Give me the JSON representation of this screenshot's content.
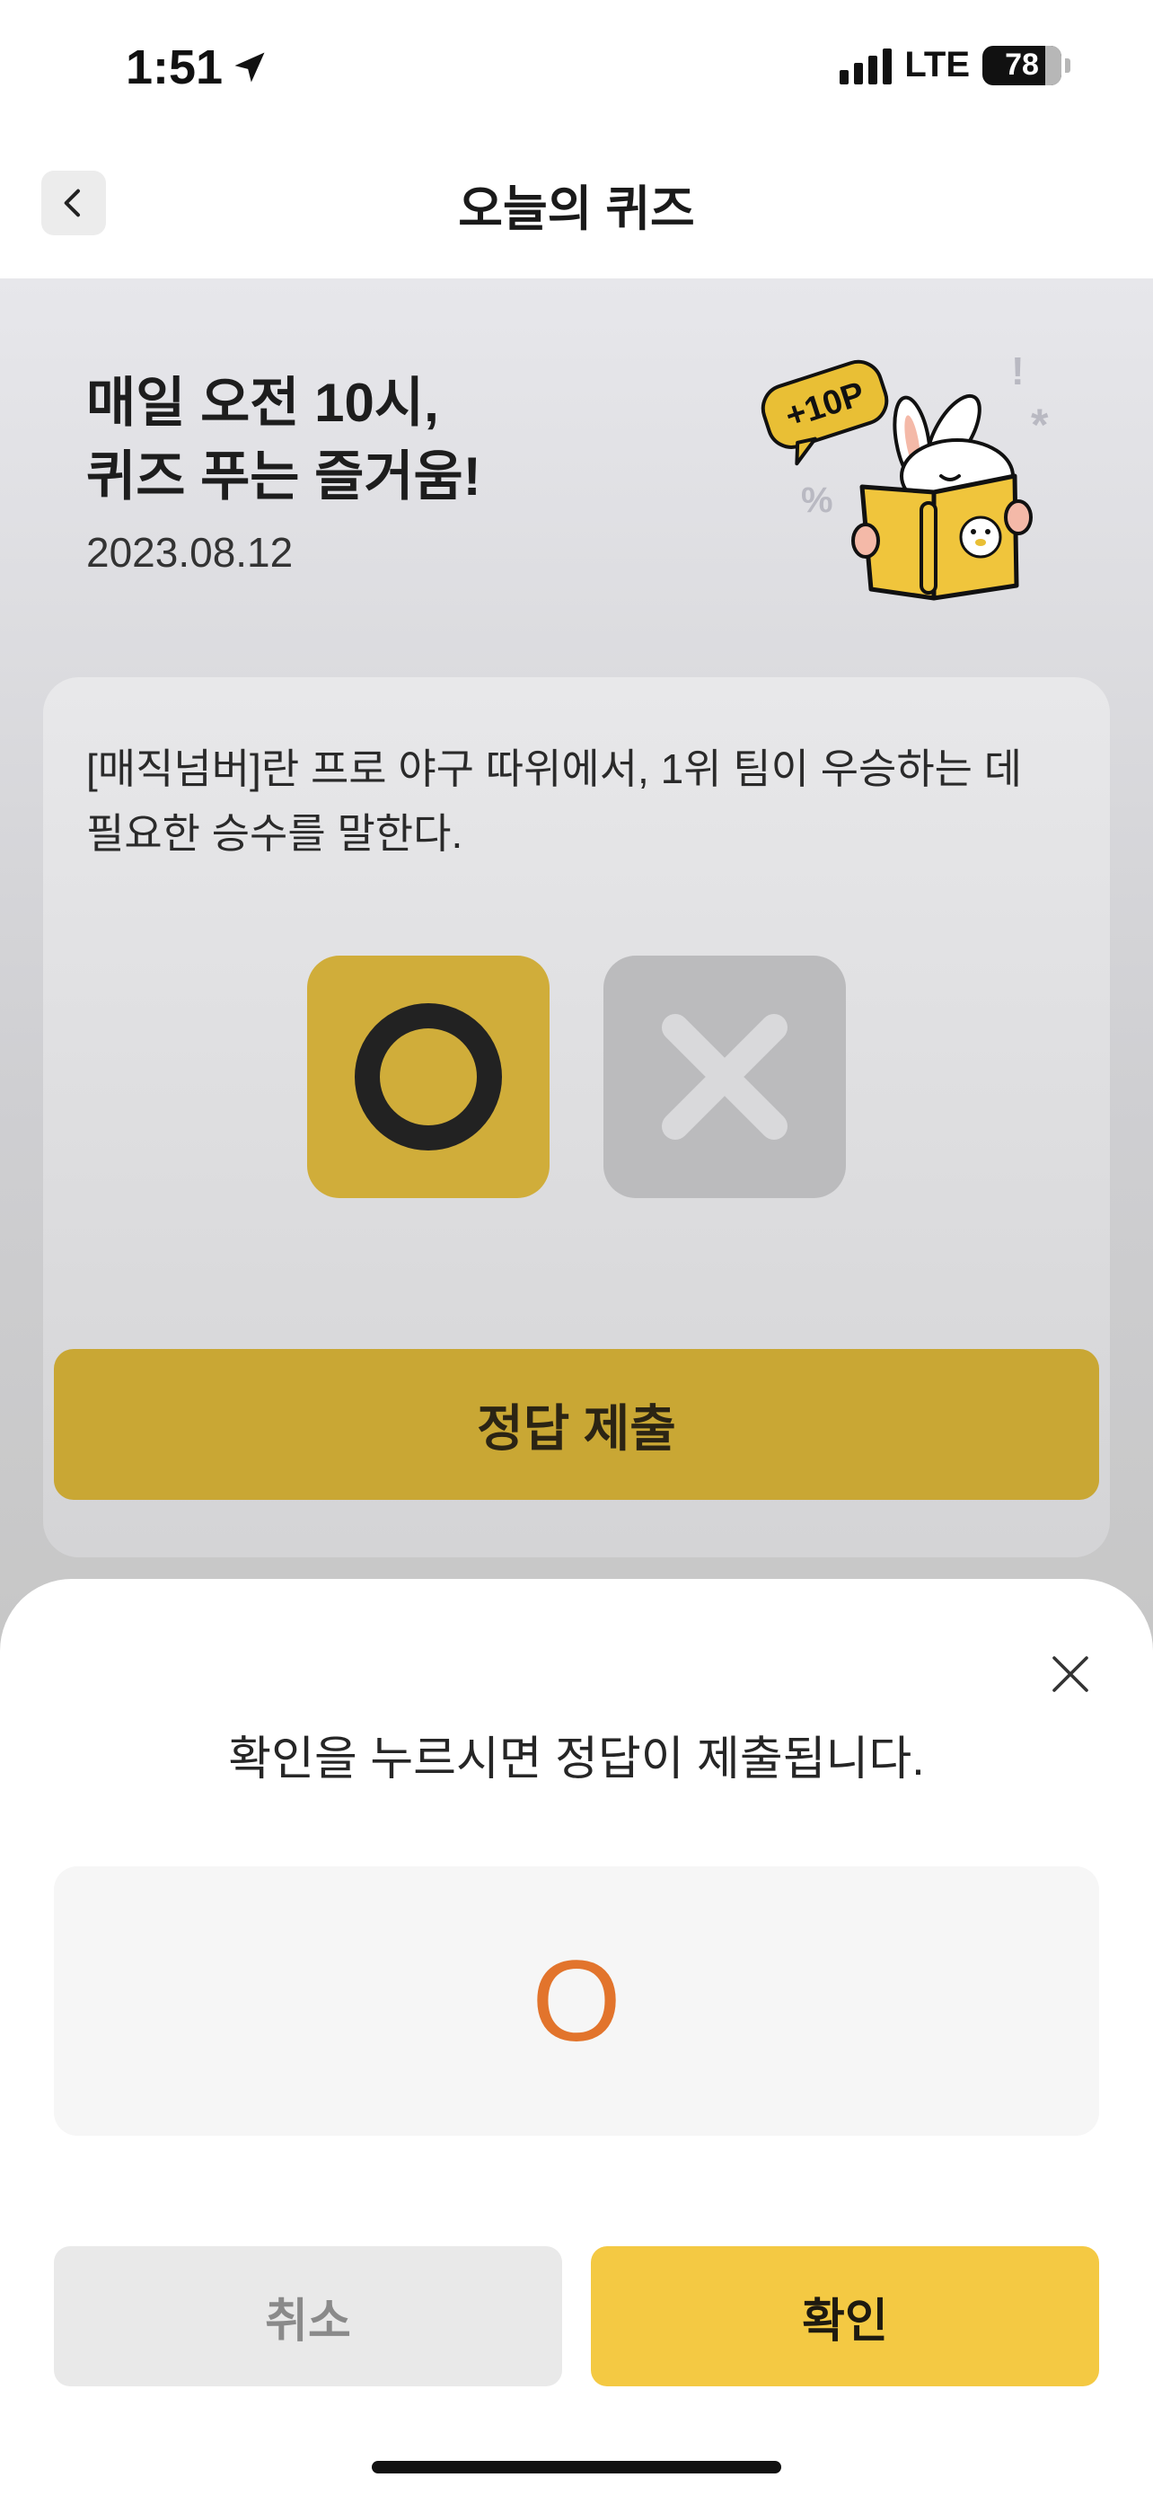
{
  "status_bar": {
    "time": "1:51",
    "network": "LTE",
    "battery": "78"
  },
  "header": {
    "title": "오늘의 퀴즈",
    "back_icon": "chevron-left-icon"
  },
  "hero": {
    "title_line1": "매일 오전 10시,",
    "title_line2": "퀴즈 푸는 즐거움!",
    "date": "2023.08.12",
    "badge": "+10P"
  },
  "quiz": {
    "question": "[매직넘버]란 프로 야구 따위에서, 1위 팀이 우승하는 데 필요한 승수를 말한다.",
    "options": [
      "O",
      "X"
    ],
    "selected": "O",
    "submit_label": "정답 제출"
  },
  "sheet": {
    "message": "확인을 누르시면 정답이 제출됩니다.",
    "answer": "O",
    "cancel_label": "취소",
    "confirm_label": "확인",
    "close_icon": "close-icon"
  },
  "colors": {
    "accent": "#f4c943",
    "answer_color": "#e2742c"
  }
}
